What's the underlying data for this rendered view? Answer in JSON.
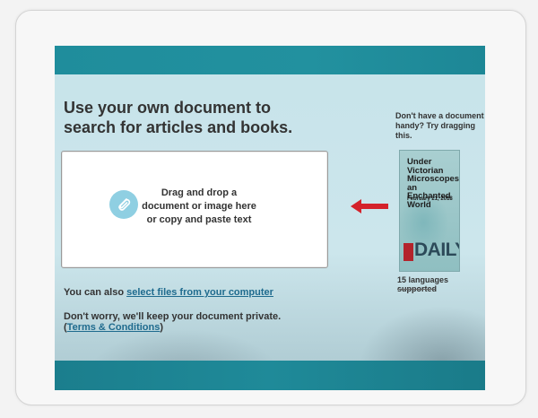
{
  "main": {
    "headline": "Use your own document to search for articles and books.",
    "dropzone": {
      "text": "Drag and drop a document or image here or copy and paste text",
      "icon": "paperclip-icon"
    },
    "also_prefix": "You can also",
    "also_link": "select files from your computer",
    "privacy_text": "Don't worry, we'll keep your document private.",
    "terms_open": "(",
    "terms_link": "Terms & Conditions",
    "terms_close": ")"
  },
  "sidebar": {
    "prompt": "Don't have a document handy? Try dragging this.",
    "sample": {
      "title": "Under Victorian Microscopes, an Enchanted World",
      "date": "February 21, 2018",
      "brand": "DAILY"
    },
    "languages": "15 languages supported"
  },
  "colors": {
    "bar": "#1f8d9c",
    "screen_bg": "#c7e3ea",
    "arrow": "#d4222b",
    "link": "#1f6b8e",
    "icon_circle": "#8fcfe2"
  }
}
